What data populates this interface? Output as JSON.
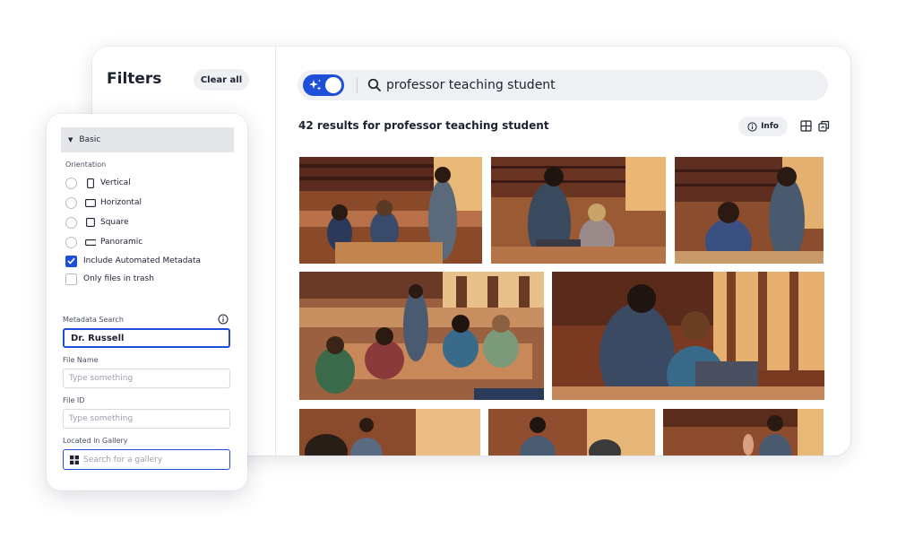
{
  "filters": {
    "title": "Filters",
    "clear_all": "Clear all",
    "basic_section": "Basic",
    "orientation_label": "Orientation",
    "orientation_options": [
      "Vertical",
      "Horizontal",
      "Square",
      "Panoramic"
    ],
    "include_metadata": {
      "label": "Include Automated Metadata",
      "checked": true
    },
    "only_trash": {
      "label": "Only files in trash",
      "checked": false
    },
    "metadata_search": {
      "label": "Metadata Search",
      "value": "Dr. Russell"
    },
    "file_name": {
      "label": "File Name",
      "placeholder": "Type something"
    },
    "file_id": {
      "label": "File ID",
      "placeholder": "Type something"
    },
    "gallery": {
      "label": "Located in Gallery",
      "placeholder": "Search for a gallery"
    }
  },
  "search": {
    "query": "professor teaching student",
    "ai_toggle_on": true
  },
  "results": {
    "count_text": "42 results for professor teaching student",
    "info_label": "Info",
    "thumbnails": [
      "classroom-photo-1",
      "classroom-photo-2",
      "classroom-photo-3",
      "classroom-photo-4",
      "classroom-photo-5",
      "classroom-photo-6",
      "classroom-photo-7",
      "classroom-photo-8"
    ]
  },
  "colors": {
    "accent": "#1f4ed8",
    "panel_bg": "#ffffff",
    "chip_bg": "#eef0f4"
  }
}
